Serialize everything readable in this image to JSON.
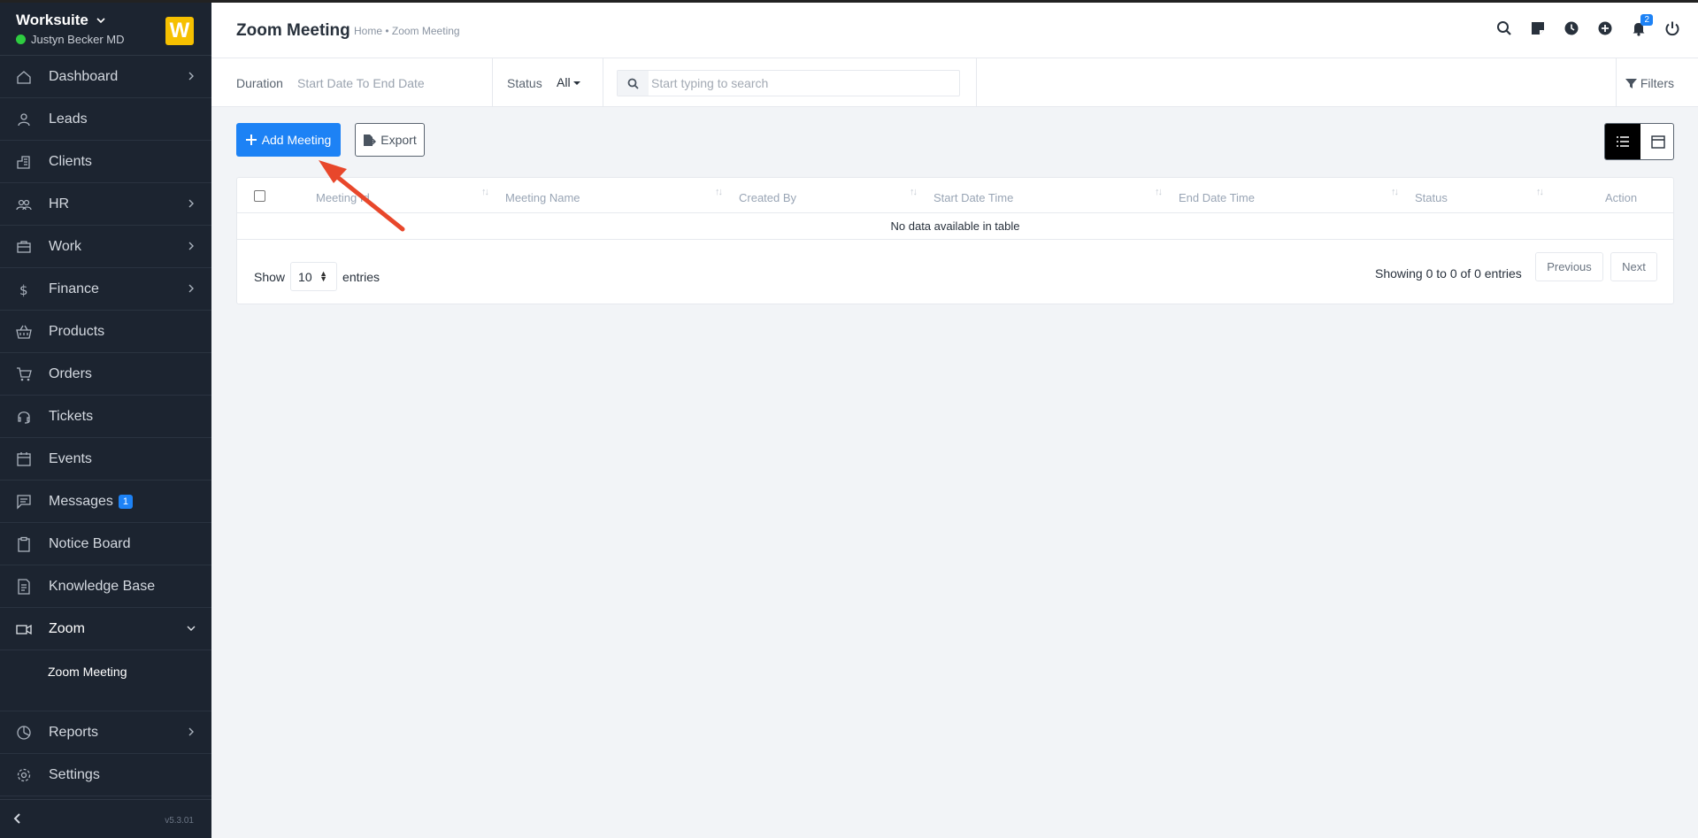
{
  "sidebar": {
    "brand": "Worksuite",
    "user": "Justyn Becker MD",
    "logo_letter": "W",
    "items": [
      {
        "label": "Dashboard",
        "icon": "house-icon",
        "has_chevron": true
      },
      {
        "label": "Leads",
        "icon": "person-icon",
        "has_chevron": false
      },
      {
        "label": "Clients",
        "icon": "building-icon",
        "has_chevron": false
      },
      {
        "label": "HR",
        "icon": "people-icon",
        "has_chevron": true
      },
      {
        "label": "Work",
        "icon": "briefcase-icon",
        "has_chevron": true
      },
      {
        "label": "Finance",
        "icon": "dollar-icon",
        "has_chevron": true
      },
      {
        "label": "Products",
        "icon": "basket-icon",
        "has_chevron": false
      },
      {
        "label": "Orders",
        "icon": "cart-icon",
        "has_chevron": false
      },
      {
        "label": "Tickets",
        "icon": "headset-icon",
        "has_chevron": false
      },
      {
        "label": "Events",
        "icon": "calendar-icon",
        "has_chevron": false
      },
      {
        "label": "Messages",
        "icon": "chat-icon",
        "has_chevron": false,
        "badge": "1"
      },
      {
        "label": "Notice Board",
        "icon": "clipboard-icon",
        "has_chevron": false
      },
      {
        "label": "Knowledge Base",
        "icon": "document-icon",
        "has_chevron": false
      },
      {
        "label": "Zoom",
        "icon": "video-icon",
        "has_chevron": true,
        "expanded": true
      }
    ],
    "sub_item": "Zoom Meeting",
    "items_after": [
      {
        "label": "Reports",
        "icon": "pie-chart-icon",
        "has_chevron": true
      },
      {
        "label": "Settings",
        "icon": "gear-icon",
        "has_chevron": false
      }
    ],
    "version": "v5.3.01"
  },
  "header": {
    "title": "Zoom Meeting",
    "breadcrumb": "Home • Zoom Meeting",
    "notification_count": "2",
    "icons": [
      "search-icon",
      "sticky-note-icon",
      "clock-icon",
      "plus-circle-icon",
      "bell-icon",
      "power-icon"
    ]
  },
  "filters": {
    "duration_label": "Duration",
    "duration_value": "Start Date To End Date",
    "status_label": "Status",
    "status_value": "All",
    "search_placeholder": "Start typing to search",
    "filters_label": "Filters"
  },
  "actions": {
    "add_label": "Add Meeting",
    "export_label": "Export"
  },
  "table": {
    "columns": [
      "Meeting Id",
      "Meeting Name",
      "Created By",
      "Start Date Time",
      "End Date Time",
      "Status",
      "Action"
    ],
    "empty_text": "No data available in table",
    "show_label": "Show",
    "page_size": "10",
    "entries_label": "entries",
    "info": "Showing 0 to 0 of 0 entries",
    "prev_label": "Previous",
    "next_label": "Next"
  },
  "colors": {
    "sidebar_bg": "#1c2430",
    "accent": "#1d82f5",
    "annotation_arrow": "#e8472b"
  }
}
